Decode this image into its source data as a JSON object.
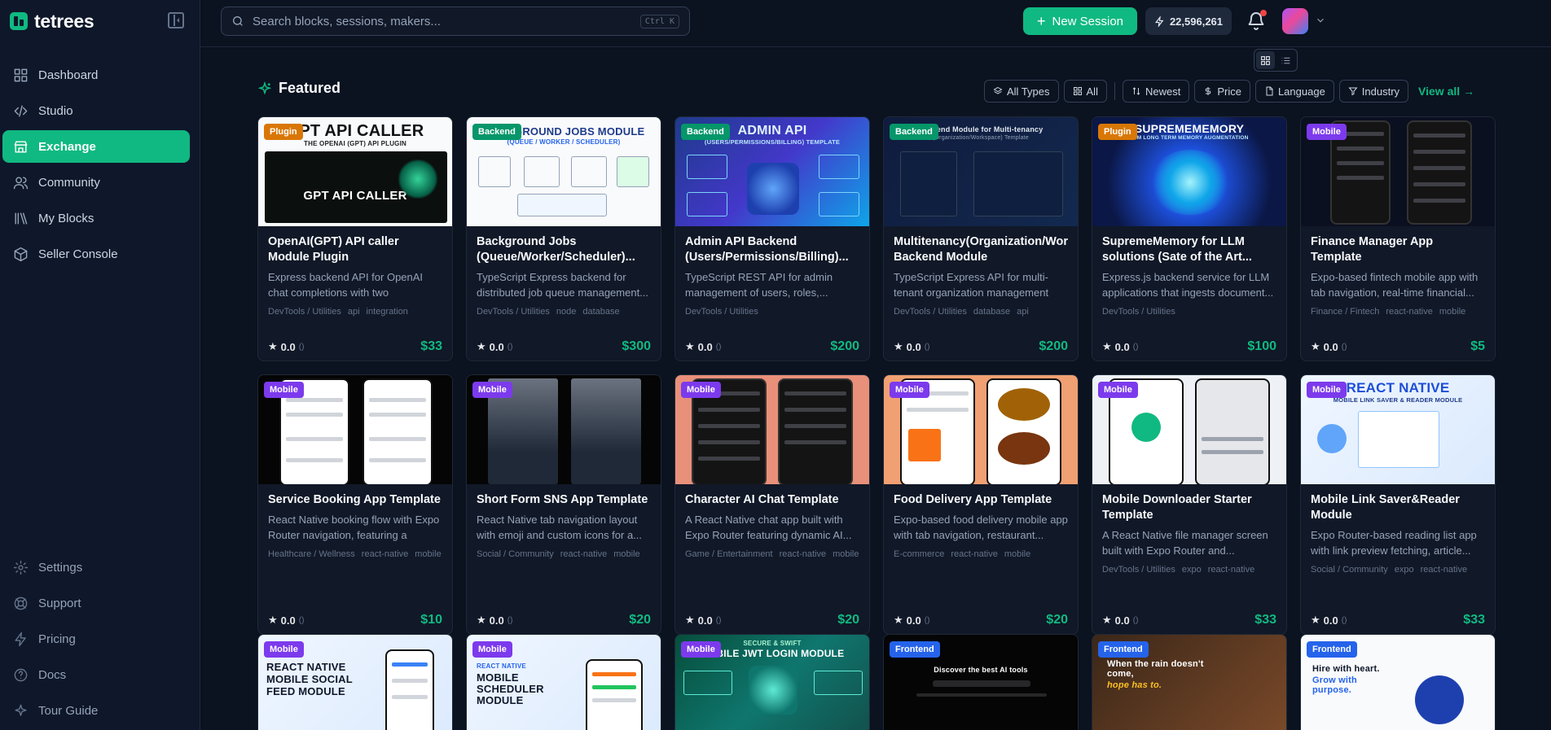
{
  "brand": {
    "name": "tetrees"
  },
  "nav": {
    "main": [
      {
        "label": "Dashboard",
        "icon": "grid-icon"
      },
      {
        "label": "Studio",
        "icon": "code-icon"
      },
      {
        "label": "Exchange",
        "icon": "store-icon",
        "active": true
      },
      {
        "label": "Community",
        "icon": "users-icon"
      },
      {
        "label": "My Blocks",
        "icon": "library-icon"
      },
      {
        "label": "Seller Console",
        "icon": "package-icon"
      }
    ],
    "bottom": [
      {
        "label": "Settings",
        "icon": "gear-icon"
      },
      {
        "label": "Support",
        "icon": "lifebuoy-icon"
      },
      {
        "label": "Pricing",
        "icon": "bolt-icon"
      },
      {
        "label": "Docs",
        "icon": "help-icon"
      },
      {
        "label": "Tour Guide",
        "icon": "sparkle-icon"
      }
    ]
  },
  "topbar": {
    "search_placeholder": "Search blocks, sessions, makers...",
    "search_shortcut": "Ctrl K",
    "new_session_label": "New Session",
    "credits": "22,596,261"
  },
  "section": {
    "title": "Featured",
    "filters": [
      "All Types",
      "All",
      "Newest",
      "Price",
      "Language",
      "Industry"
    ],
    "view_all": "View all"
  },
  "colors": {
    "accent": "#10b981",
    "plugin": "#d97706",
    "backend": "#059669",
    "mobile": "#7c3aed",
    "frontend": "#2563eb"
  },
  "cards": [
    {
      "badge": "Plugin",
      "thumb_text": "GPT API CALLER",
      "thumb_sub": "THE OPENAI (GPT) API PLUGIN",
      "title": "OpenAI(GPT) API caller Module Plugin",
      "desc": "Express backend API for OpenAI chat completions with two configurable...",
      "category": "DevTools / Utilities",
      "tags": [
        "api",
        "integration"
      ],
      "rating": "0.0",
      "count": "()",
      "price": "$33"
    },
    {
      "badge": "Backend",
      "thumb_text": "BACKGROUND JOBS MODULE",
      "thumb_sub": "(QUEUE / WORKER / SCHEDULER)",
      "title": "Background Jobs (Queue/Worker/Scheduler)...",
      "desc": "TypeScript Express backend for distributed job queue management...",
      "category": "DevTools / Utilities",
      "tags": [
        "node",
        "database"
      ],
      "rating": "0.0",
      "count": "()",
      "price": "$300"
    },
    {
      "badge": "Backend",
      "thumb_text": "ADMIN API",
      "thumb_sub": "(USERS/PERMISSIONS/BILLING) TEMPLATE",
      "title": "Admin API Backend (Users/Permissions/Billing)...",
      "desc": "TypeScript REST API for admin management of users, roles,...",
      "category": "DevTools / Utilities",
      "tags": [],
      "rating": "0.0",
      "count": "()",
      "price": "$200"
    },
    {
      "badge": "Backend",
      "thumb_text": "Backend Module for Multi-tenancy",
      "thumb_sub": "(Organization/Workspace) Template",
      "title": "Multitenancy(Organization/Wor Backend Module",
      "desc": "TypeScript Express API for multi-tenant organization management wi...",
      "category": "DevTools / Utilities",
      "tags": [
        "database",
        "api"
      ],
      "rating": "0.0",
      "count": "()",
      "price": "$200"
    },
    {
      "badge": "Plugin",
      "thumb_text": "SUPREMEMEMORY",
      "thumb_sub": "LLM LONG TERM MEMORY AUGMENTATION",
      "title": "SupremeMemory for LLM solutions (Sate of the Art...",
      "desc": "Express.js backend service for LLM applications that ingests document...",
      "category": "DevTools / Utilities",
      "tags": [],
      "rating": "0.0",
      "count": "()",
      "price": "$100"
    },
    {
      "badge": "Mobile",
      "thumb_text": "",
      "thumb_sub": "",
      "title": "Finance Manager App Template",
      "desc": "Expo-based fintech mobile app with tab navigation, real-time financial...",
      "category": "Finance / Fintech",
      "tags": [
        "react-native",
        "mobile"
      ],
      "rating": "0.0",
      "count": "()",
      "price": "$5"
    },
    {
      "badge": "Mobile",
      "thumb_text": "",
      "thumb_sub": "",
      "title": "Service Booking App Template",
      "desc": "React Native booking flow with Expo Router navigation, featuring a multi-...",
      "category": "Healthcare / Wellness",
      "tags": [
        "react-native",
        "mobile"
      ],
      "rating": "0.0",
      "count": "()",
      "price": "$10"
    },
    {
      "badge": "Mobile",
      "thumb_text": "",
      "thumb_sub": "",
      "title": "Short Form SNS App Template",
      "desc": "React Native tab navigation layout with emoji and custom icons for a...",
      "category": "Social / Community",
      "tags": [
        "react-native",
        "mobile"
      ],
      "rating": "0.0",
      "count": "()",
      "price": "$20"
    },
    {
      "badge": "Mobile",
      "thumb_text": "",
      "thumb_sub": "",
      "title": "Character AI Chat Template",
      "desc": "A React Native chat app built with Expo Router featuring dynamic AI...",
      "category": "Game / Entertainment",
      "tags": [
        "react-native",
        "mobile"
      ],
      "rating": "0.0",
      "count": "()",
      "price": "$20"
    },
    {
      "badge": "Mobile",
      "thumb_text": "",
      "thumb_sub": "",
      "title": "Food Delivery App Template",
      "desc": "Expo-based food delivery mobile app with tab navigation, restaurant...",
      "category": "E-commerce",
      "tags": [
        "react-native",
        "mobile"
      ],
      "rating": "0.0",
      "count": "()",
      "price": "$20"
    },
    {
      "badge": "Mobile",
      "thumb_text": "",
      "thumb_sub": "",
      "title": "Mobile Downloader Starter Template",
      "desc": "A React Native file manager screen built with Expo Router and...",
      "category": "DevTools / Utilities",
      "tags": [
        "expo",
        "react-native"
      ],
      "rating": "0.0",
      "count": "()",
      "price": "$33"
    },
    {
      "badge": "Mobile",
      "thumb_text": "REACT NATIVE",
      "thumb_sub": "MOBILE LINK SAVER & READER MODULE",
      "title": "Mobile Link Saver&Reader Module",
      "desc": "Expo Router-based reading list app with link preview fetching, article...",
      "category": "Social / Community",
      "tags": [
        "expo",
        "react-native"
      ],
      "rating": "0.0",
      "count": "()",
      "price": "$33"
    },
    {
      "badge": "Mobile",
      "thumb_text": "REACT NATIVE MOBILE SOCIAL FEED MODULE",
      "thumb_sub": "",
      "title": "",
      "desc": "",
      "category": "",
      "tags": [],
      "rating": "",
      "count": "",
      "price": ""
    },
    {
      "badge": "Mobile",
      "thumb_text": "MOBILE SCHEDULER MODULE",
      "thumb_sub": "REACT NATIVE",
      "title": "",
      "desc": "",
      "category": "",
      "tags": [],
      "rating": "",
      "count": "",
      "price": ""
    },
    {
      "badge": "Mobile",
      "thumb_text": "MOBILE JWT LOGIN MODULE",
      "thumb_sub": "SECURE & SWIFT",
      "title": "",
      "desc": "",
      "category": "",
      "tags": [],
      "rating": "",
      "count": "",
      "price": ""
    },
    {
      "badge": "Frontend",
      "thumb_text": "Discover the best AI tools",
      "thumb_sub": "",
      "title": "",
      "desc": "",
      "category": "",
      "tags": [],
      "rating": "",
      "count": "",
      "price": ""
    },
    {
      "badge": "Frontend",
      "thumb_text": "When the rain doesn't come,",
      "thumb_sub": "hope has to.",
      "title": "",
      "desc": "",
      "category": "",
      "tags": [],
      "rating": "",
      "count": "",
      "price": ""
    },
    {
      "badge": "Frontend",
      "thumb_text": "Hire with heart.",
      "thumb_sub": "Grow with purpose.",
      "title": "",
      "desc": "",
      "category": "",
      "tags": [],
      "rating": "",
      "count": "",
      "price": ""
    }
  ]
}
